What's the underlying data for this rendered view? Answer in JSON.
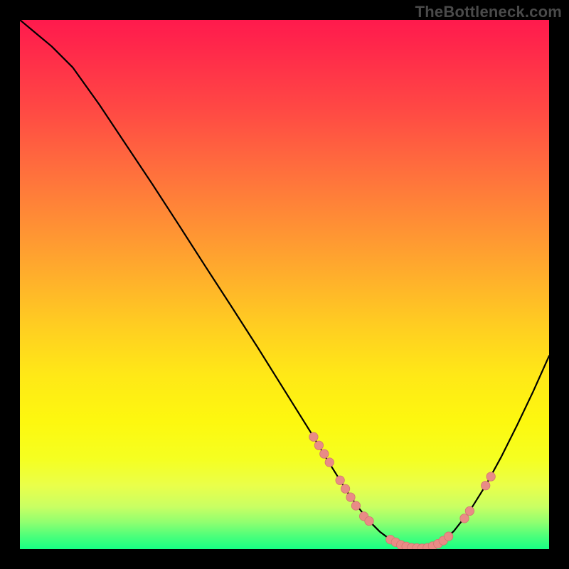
{
  "watermark": "TheBottleneck.com",
  "colors": {
    "marker_fill": "#e98b86",
    "marker_stroke": "#d1756f",
    "curve": "#000000"
  },
  "chart_data": {
    "type": "line",
    "title": "",
    "xlabel": "",
    "ylabel": "",
    "xlim": [
      0,
      100
    ],
    "ylim": [
      0,
      100
    ],
    "x": [
      0,
      3,
      6,
      10,
      15,
      20,
      25,
      30,
      35,
      40,
      45,
      50,
      55,
      58,
      60,
      62,
      64,
      66,
      68,
      70,
      72,
      74,
      76,
      78,
      80,
      82,
      85,
      88,
      91,
      94,
      97,
      100
    ],
    "y": [
      100,
      97.5,
      95,
      91,
      84,
      76.5,
      69,
      61.3,
      53.5,
      45.8,
      38,
      30,
      22,
      17,
      13.8,
      10.6,
      7.8,
      5.3,
      3.3,
      1.8,
      0.8,
      0.25,
      0.15,
      0.55,
      1.6,
      3.4,
      7.2,
      12,
      17.5,
      23.5,
      29.8,
      36.5
    ],
    "markers": {
      "x": [
        55.5,
        56.5,
        57.5,
        58.5,
        60.5,
        61.5,
        62.5,
        63.5,
        65,
        66,
        70,
        71,
        72,
        73,
        74,
        75,
        76,
        77,
        78,
        79,
        80,
        81,
        84,
        85,
        88,
        89
      ],
      "y": [
        21.2,
        19.6,
        18,
        16.4,
        13,
        11.4,
        9.8,
        8.2,
        6.2,
        5.3,
        1.8,
        1.3,
        0.8,
        0.5,
        0.25,
        0.2,
        0.15,
        0.25,
        0.55,
        1,
        1.6,
        2.4,
        5.8,
        7.2,
        12,
        13.7
      ]
    }
  }
}
